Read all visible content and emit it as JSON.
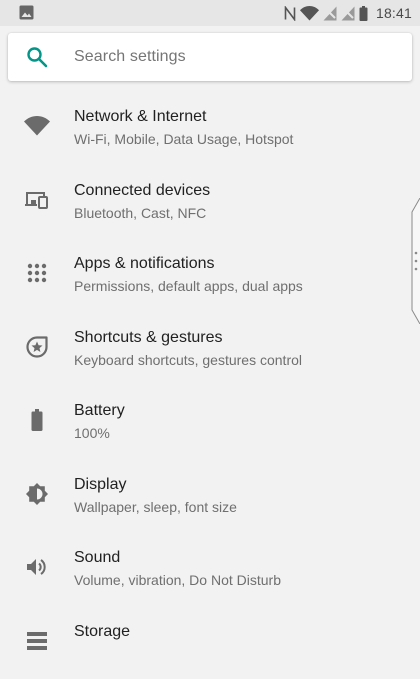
{
  "status_bar": {
    "time": "18:41",
    "nfc_glyph": "N",
    "icons": [
      "image-icon",
      "nfc-icon",
      "wifi-icon",
      "signal-off-icon",
      "signal-off-icon",
      "battery-icon"
    ]
  },
  "search": {
    "placeholder": "Search settings",
    "icon": "search-icon",
    "accent_color": "#009688"
  },
  "items": [
    {
      "title": "Network & Internet",
      "subtitle": "Wi-Fi, Mobile, Data Usage, Hotspot",
      "icon": "wifi-icon"
    },
    {
      "title": "Connected devices",
      "subtitle": "Bluetooth, Cast, NFC",
      "icon": "devices-icon"
    },
    {
      "title": "Apps & notifications",
      "subtitle": "Permissions, default apps, dual apps",
      "icon": "apps-grid-icon"
    },
    {
      "title": "Shortcuts & gestures",
      "subtitle": "Keyboard shortcuts, gestures control",
      "icon": "shortcut-star-icon"
    },
    {
      "title": "Battery",
      "subtitle": "100%",
      "icon": "battery-icon"
    },
    {
      "title": "Display",
      "subtitle": "Wallpaper, sleep, font size",
      "icon": "brightness-icon"
    },
    {
      "title": "Sound",
      "subtitle": "Volume, vibration, Do Not Disturb",
      "icon": "volume-icon"
    },
    {
      "title": "Storage",
      "subtitle": "",
      "icon": "storage-icon"
    }
  ],
  "colors": {
    "background": "#f2f2f2",
    "status_bar": "#e6e6e6",
    "icon": "#6b6b6b",
    "title": "#212121",
    "subtitle": "#6f6f6f"
  }
}
